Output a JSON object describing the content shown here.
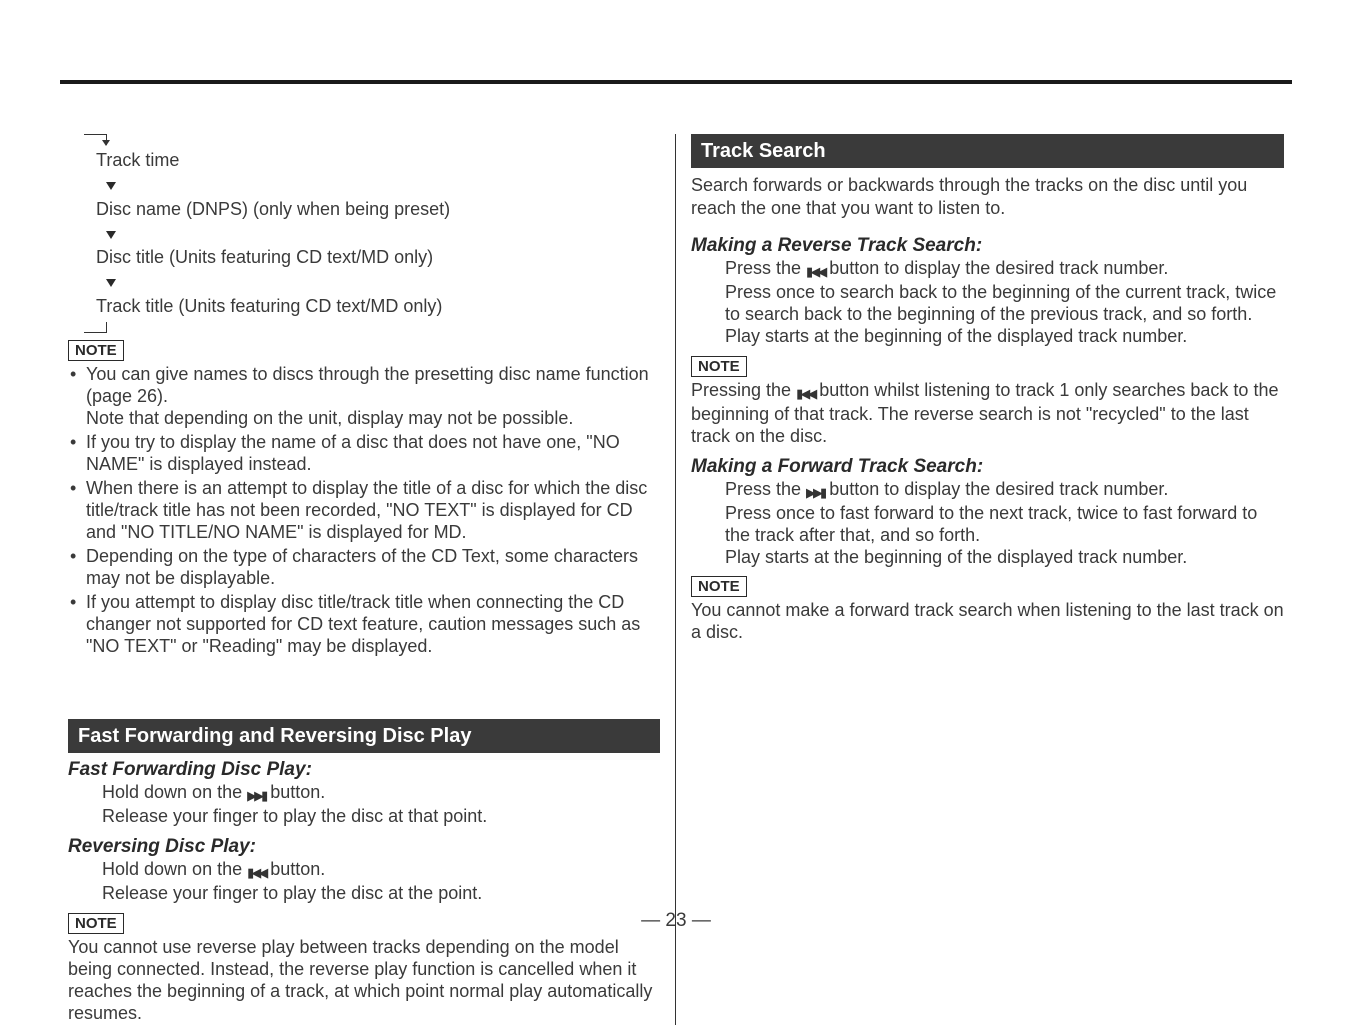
{
  "left": {
    "flow": {
      "l1": "Track time",
      "l2": "Disc name (DNPS) (only when being preset)",
      "l3": "Disc title (Units featuring CD text/MD only)",
      "l4": "Track title (Units featuring CD text/MD only)"
    },
    "note_label": "NOTE",
    "notes": {
      "n1a": "You can give names to discs through the presetting disc name function (page 26).",
      "n1b": "Note that depending on the unit, display may not be possible.",
      "n2": "If you try to display the name of a disc that does not have one, \"NO NAME\" is displayed instead.",
      "n3": "When there is an attempt to display the title of a disc for which the disc title/track title has not been recorded, \"NO TEXT\" is displayed for CD and \"NO TITLE/NO NAME\" is displayed for MD.",
      "n4": "Depending on the type of characters of the CD Text, some characters may not be displayable.",
      "n5": "If you attempt to display disc title/track title when connecting the CD changer not supported for CD text feature, caution messages such as \"NO TEXT\" or \"Reading\" may be displayed."
    },
    "ff": {
      "title": "Fast Forwarding and Reversing Disc Play",
      "fwd_h": "Fast Forwarding Disc Play:",
      "fwd1a": "Hold down on the ",
      "fwd1b": " button.",
      "fwd2": "Release your finger to play the disc at that point.",
      "rev_h": "Reversing Disc Play:",
      "rev1a": "Hold down on the ",
      "rev1b": " button.",
      "rev2": "Release your finger to play the disc at the point.",
      "note_label": "NOTE",
      "note": "You cannot use reverse play between tracks depending on the model being connected. Instead, the reverse play function is cancelled when it reaches the beginning of a track, at which point normal play automatically resumes."
    }
  },
  "right": {
    "ts": {
      "title": "Track Search",
      "intro": "Search forwards or backwards through the tracks on the disc until you reach the one that you want to listen to.",
      "rev_h": "Making a Reverse Track Search:",
      "rev1a": "Press the ",
      "rev1b": " button to display the desired track number.",
      "rev2": "Press once to search back to the beginning of the current track, twice to search back to the beginning of the previous track, and so forth.",
      "rev3": "Play starts at the beginning of the displayed track number.",
      "note1_label": "NOTE",
      "note1a": "Pressing the ",
      "note1b": " button whilst listening to track 1 only searches back to the beginning of that track. The reverse search is not \"recycled\" to the last track on the disc.",
      "fwd_h": "Making a Forward Track Search:",
      "fwd1a": "Press the ",
      "fwd1b": " button to display the desired track number.",
      "fwd2": "Press once to fast forward to the next track, twice to fast forward to the track after that, and so forth.",
      "fwd3": "Play starts at the beginning of the displayed track number.",
      "note2_label": "NOTE",
      "note2": "You cannot make a forward track search when listening to the last track on a disc."
    }
  },
  "page_number": "— 23 —"
}
